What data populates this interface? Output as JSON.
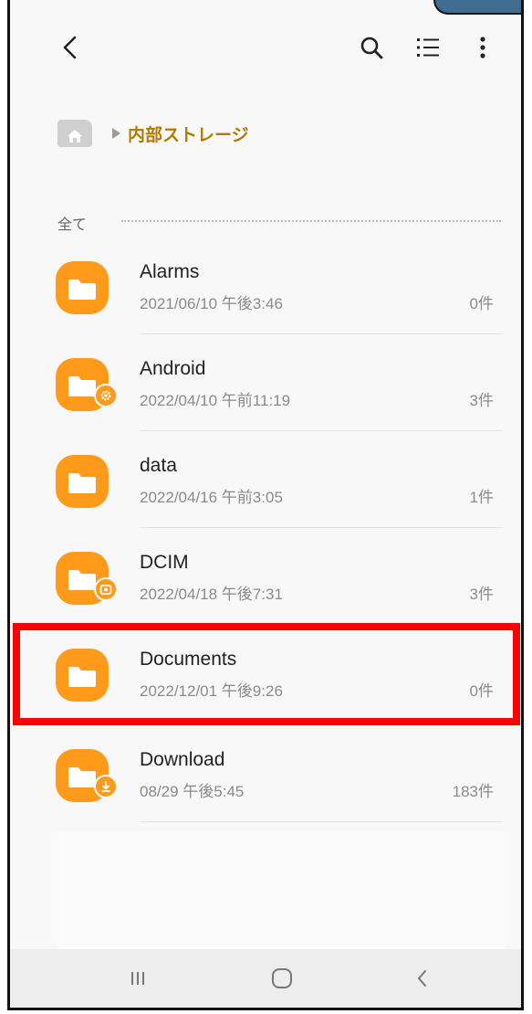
{
  "breadcrumb": {
    "label": "内部ストレージ"
  },
  "section": {
    "label": "全て"
  },
  "items": [
    {
      "name": "Alarms",
      "date": "2021/06/10 午後3:46",
      "count": "0件",
      "badge": ""
    },
    {
      "name": "Android",
      "date": "2022/04/10 午前11:19",
      "count": "3件",
      "badge": "gear-icon"
    },
    {
      "name": "data",
      "date": "2022/04/16 午前3:05",
      "count": "1件",
      "badge": ""
    },
    {
      "name": "DCIM",
      "date": "2022/04/18 午後7:31",
      "count": "3件",
      "badge": "camera-icon"
    },
    {
      "name": "Documents",
      "date": "2022/12/01 午後9:26",
      "count": "0件",
      "badge": ""
    },
    {
      "name": "Download",
      "date": "08/29 午後5:45",
      "count": "183件",
      "badge": "download-icon"
    }
  ],
  "icons": {
    "back": "back-arrow-icon",
    "search": "search-icon",
    "list_view": "list-view-icon",
    "more": "more-vert-icon",
    "home": "home-icon",
    "folder": "folder-icon"
  },
  "colors": {
    "folder": "#ff9a1a",
    "breadcrumb_text": "#b27a00",
    "highlight": "#ff0000",
    "background": "#f8f8f8"
  }
}
